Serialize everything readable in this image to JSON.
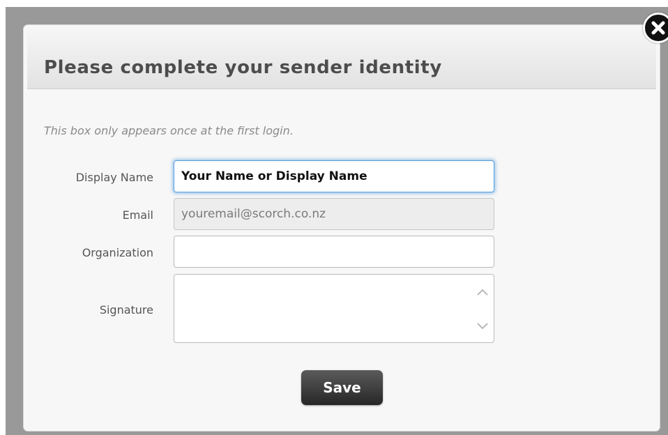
{
  "dialog": {
    "title": "Please complete your sender identity",
    "hint": "This box only appears once at the first login.",
    "close_icon": "close-x-circle-icon"
  },
  "form": {
    "display_name": {
      "label": "Display Name",
      "value": "Your Name or Display Name"
    },
    "email": {
      "label": "Email",
      "value": "youremail@scorch.co.nz"
    },
    "organization": {
      "label": "Organization",
      "value": ""
    },
    "signature": {
      "label": "Signature",
      "value": ""
    }
  },
  "actions": {
    "save_label": "Save"
  },
  "colors": {
    "focus_ring": "#5a9fdb",
    "button_bg": "#3a3a3a",
    "title_text": "#4d4d4d"
  }
}
